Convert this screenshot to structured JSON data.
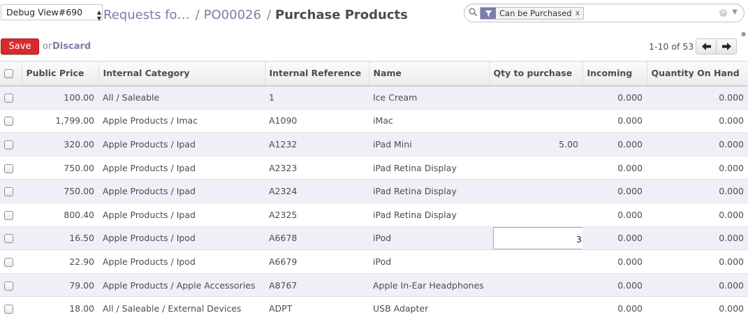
{
  "debug": {
    "selected": "Debug View#690"
  },
  "breadcrumb": {
    "link1": "Requests fo…",
    "link2": "PO00026",
    "current": "Purchase Products",
    "separator": "/"
  },
  "search": {
    "facet_value": "Can be Purchased",
    "facet_remove": "x",
    "placeholder": ""
  },
  "buttons": {
    "save": "Save",
    "or": "or",
    "discard": "Discard"
  },
  "pager": {
    "value": "1-10 of 53",
    "prev": "◀",
    "next": "▶"
  },
  "columns": [
    "Public Price",
    "Internal Category",
    "Internal Reference",
    "Name",
    "Qty to purchase",
    "Incoming",
    "Quantity On Hand"
  ],
  "rows": [
    {
      "price": "100.00",
      "category": "All / Saleable",
      "ref": "1",
      "name": "Ice Cream",
      "qty": "",
      "incoming": "0.000",
      "on_hand": "0.000"
    },
    {
      "price": "1,799.00",
      "category": "Apple Products / Imac",
      "ref": "A1090",
      "name": "iMac",
      "qty": "",
      "incoming": "0.000",
      "on_hand": "0.000"
    },
    {
      "price": "320.00",
      "category": "Apple Products / Ipad",
      "ref": "A1232",
      "name": "iPad Mini",
      "qty": "5.00",
      "incoming": "0.000",
      "on_hand": "0.000"
    },
    {
      "price": "750.00",
      "category": "Apple Products / Ipad",
      "ref": "A2323",
      "name": "iPad Retina Display",
      "qty": "",
      "incoming": "0.000",
      "on_hand": "0.000"
    },
    {
      "price": "750.00",
      "category": "Apple Products / Ipad",
      "ref": "A2324",
      "name": "iPad Retina Display",
      "qty": "",
      "incoming": "0.000",
      "on_hand": "0.000"
    },
    {
      "price": "800.40",
      "category": "Apple Products / Ipad",
      "ref": "A2325",
      "name": "iPad Retina Display",
      "qty": "",
      "incoming": "0.000",
      "on_hand": "0.000"
    },
    {
      "price": "16.50",
      "category": "Apple Products / Ipod",
      "ref": "A6678",
      "name": "iPod",
      "qty": "3",
      "incoming": "0.000",
      "on_hand": "0.000"
    },
    {
      "price": "22.90",
      "category": "Apple Products / Ipod",
      "ref": "A6679",
      "name": "iPod",
      "qty": "",
      "incoming": "0.000",
      "on_hand": "0.000"
    },
    {
      "price": "79.00",
      "category": "Apple Products / Apple Accessories",
      "ref": "A8767",
      "name": "Apple In-Ear Headphones",
      "qty": "",
      "incoming": "0.000",
      "on_hand": "0.000"
    },
    {
      "price": "18.00",
      "category": "All / Saleable / External Devices",
      "ref": "ADPT",
      "name": "USB Adapter",
      "qty": "",
      "incoming": "0.000",
      "on_hand": "0.000"
    }
  ],
  "colors": {
    "accent": "#7c7bad",
    "save_button": "#d9292f",
    "row_stripe": "#efeff8"
  }
}
